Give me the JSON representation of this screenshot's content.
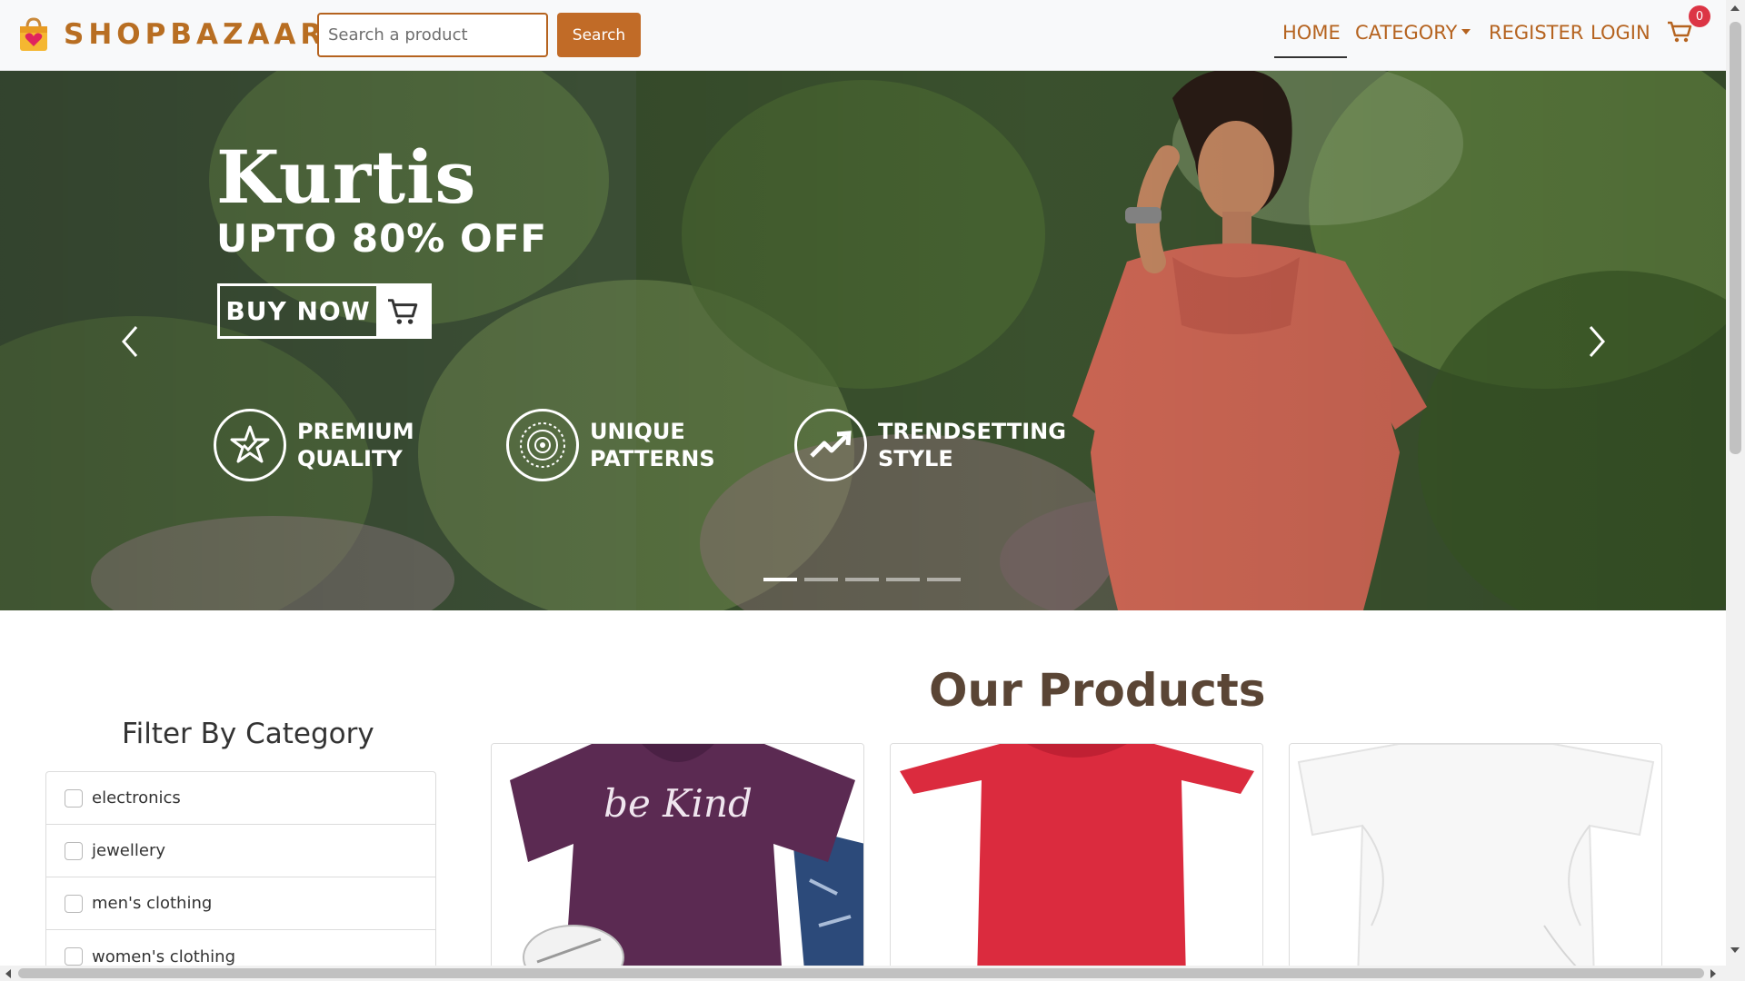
{
  "brand": {
    "name": "SHOPBAZAAR",
    "icon": "shopping-bag-heart-icon",
    "color": "#b86e22"
  },
  "search": {
    "placeholder": "Search a product",
    "value": "",
    "button_label": "Search"
  },
  "nav": {
    "home": "HOME",
    "category": "CATEGORY",
    "register": "REGISTER",
    "login": "LOGIN",
    "cart_icon": "cart-icon",
    "cart_count": "0",
    "active": "HOME"
  },
  "hero": {
    "title": "Kurtis",
    "subtitle": "UPTO 80% OFF",
    "buy_now": "BUY NOW",
    "features": [
      {
        "line1": "PREMIUM",
        "line2": "QUALITY",
        "icon": "star-badge-icon"
      },
      {
        "line1": "UNIQUE",
        "line2": "PATTERNS",
        "icon": "mandala-icon"
      },
      {
        "line1": "TRENDSETTING",
        "line2": "STYLE",
        "icon": "trend-up-icon"
      }
    ],
    "slides": 5,
    "active_slide": 1
  },
  "filter": {
    "title": "Filter By Category",
    "categories": [
      "electronics",
      "jewellery",
      "men's clothing",
      "women's clothing"
    ]
  },
  "products": {
    "title": "Our Products",
    "items": [
      {
        "name": "purple-tshirt",
        "print": "be Kind"
      },
      {
        "name": "red-tshirt"
      },
      {
        "name": "white-top"
      }
    ]
  },
  "colors": {
    "accent": "#c16b27",
    "heading": "#5a4535",
    "badge": "#dc3545"
  }
}
